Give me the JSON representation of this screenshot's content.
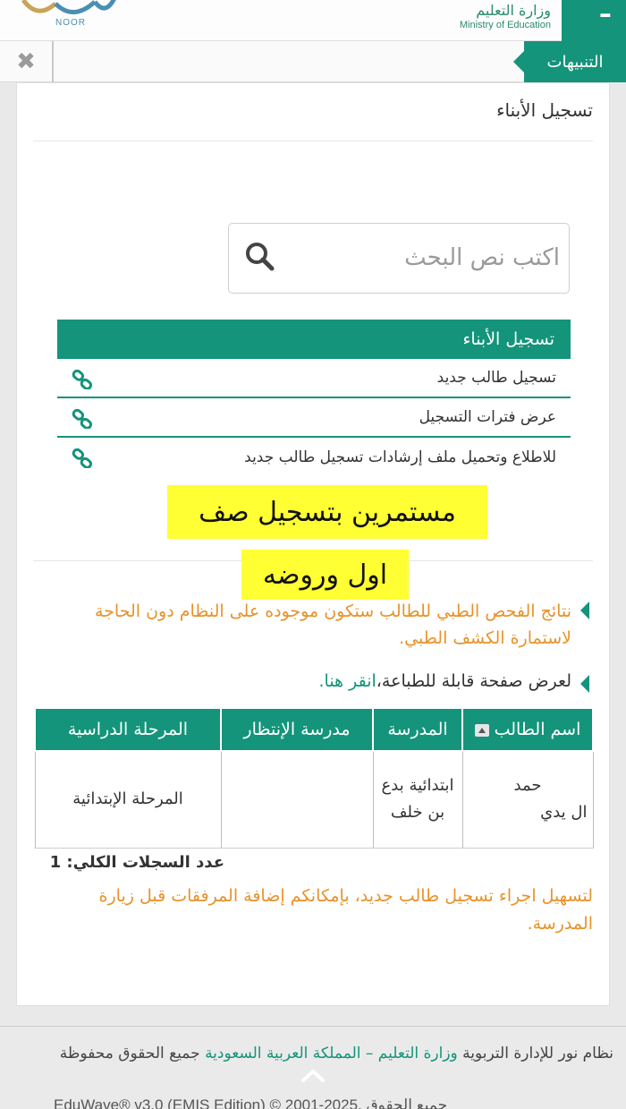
{
  "header": {
    "noor_label": "NOOR",
    "ministry_ar": "وزارة التعليم",
    "ministry_en": "Ministry of Education"
  },
  "notifications": {
    "tab_label": "التنبيهات",
    "close_glyph": "✖"
  },
  "panel": {
    "title": "تسجيل الأبناء"
  },
  "search": {
    "placeholder": "اكتب نص البحث"
  },
  "menu": {
    "header": "تسجيل الأبناء",
    "items": [
      {
        "label": "تسجيل طالب جديد"
      },
      {
        "label": "عرض فترات التسجيل"
      },
      {
        "label": "للاطلاع وتحميل ملف إرشادات تسجيل طالب جديد"
      }
    ]
  },
  "highlights": {
    "line1": "مستمرين بتسجيل صف",
    "line2": "اول وروضه"
  },
  "notes": {
    "medical": "نتائج الفحص الطبي للطالب ستكون موجوده على النظام دون الحاجة لاستمارة الكشف الطبي.",
    "print_prefix": "لعرض صفحة قابلة للطباعة،",
    "print_link": "انقر هنا."
  },
  "table": {
    "headers": [
      "اسم الطالب",
      "المدرسة",
      "مدرسة الإنتظار",
      "المرحلة الدراسية"
    ],
    "rows": [
      {
        "student_line1": "حمد",
        "student_line2": "ال  يدي",
        "school": "ابتدائية بدع بن خلف",
        "waiting_school": "",
        "stage": "المرحلة الإبتدائية"
      }
    ]
  },
  "total": {
    "label": "عدد السجلات الكلي: 1"
  },
  "attachments_note": "لتسهيل اجراء تسجيل طالب جديد، بإمكانكم إضافة المرفقات قبل زيارة المدرسة.",
  "footer": {
    "part1": "نظام نور للإدارة التربوية",
    "part2": "وزارة التعليم – المملكة العربية السعودية",
    "part3": "جميع الحقوق محفوظة",
    "version": "EduWave® v3.0 (EMIS Edition) © 2001-2025, جميع الحقوق"
  },
  "colors": {
    "brand": "#14947a",
    "warning_text": "#e8922a",
    "highlight": "#ffff33"
  }
}
